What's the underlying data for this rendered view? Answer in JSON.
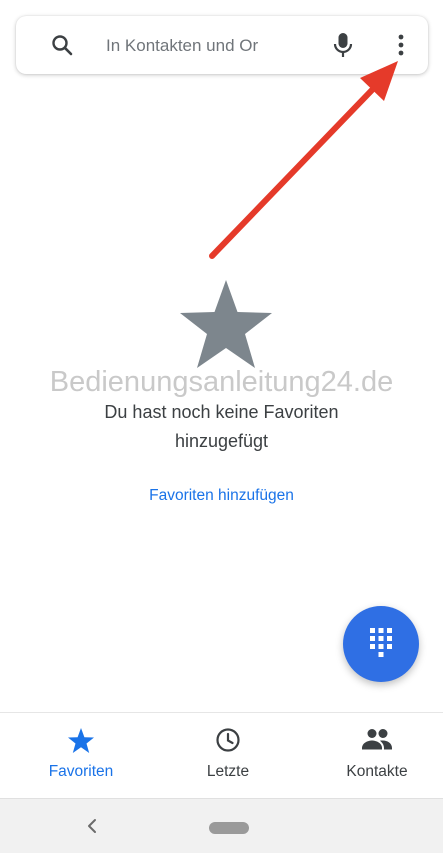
{
  "search": {
    "placeholder": "In Kontakten und Or"
  },
  "watermark": {
    "text": "Bedienungsanleitung24.de"
  },
  "empty_state": {
    "title": "Du hast noch keine Favoriten",
    "subtitle": "hinzugefügt",
    "action_label": "Favoriten hinzufügen"
  },
  "bottom_nav": {
    "items": [
      {
        "label": "Favoriten",
        "icon": "star-icon",
        "active": true
      },
      {
        "label": "Letzte",
        "icon": "clock-icon",
        "active": false
      },
      {
        "label": "Kontakte",
        "icon": "people-icon",
        "active": false
      }
    ]
  },
  "colors": {
    "accent": "#1a73e8",
    "fab": "#2f6fe4",
    "annotation_arrow": "#e53a2a",
    "empty_star": "#7d868d"
  }
}
